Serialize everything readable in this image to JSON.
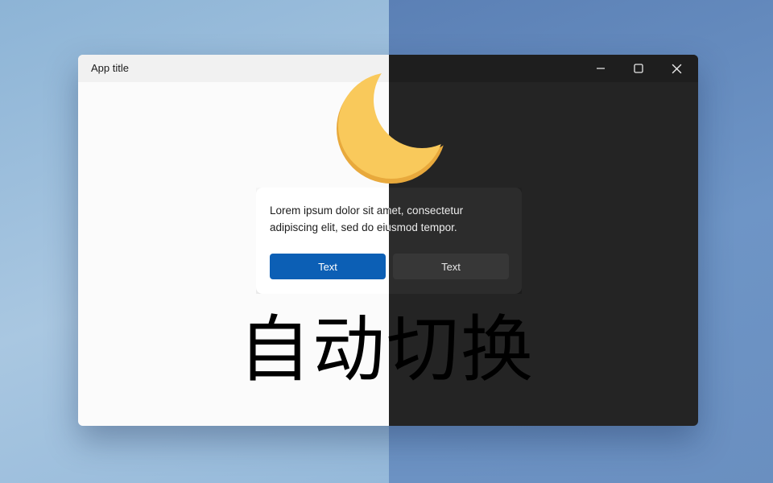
{
  "window": {
    "title": "App title",
    "controls": [
      "minimize-icon",
      "maximize-icon",
      "close-icon"
    ]
  },
  "dialog": {
    "body": "Lorem ipsum dolor sit amet, consectetur adipiscing elit, sed do eiusmod tempor.",
    "primary_button": "Text",
    "secondary_button": "Text"
  },
  "overlay": {
    "caption": "自动切换",
    "icon": "moon-icon"
  },
  "colors": {
    "accent": "#0c5fb5",
    "moon": "#f9c95b",
    "light_surface": "#fbfbfb",
    "dark_surface": "#242424"
  }
}
